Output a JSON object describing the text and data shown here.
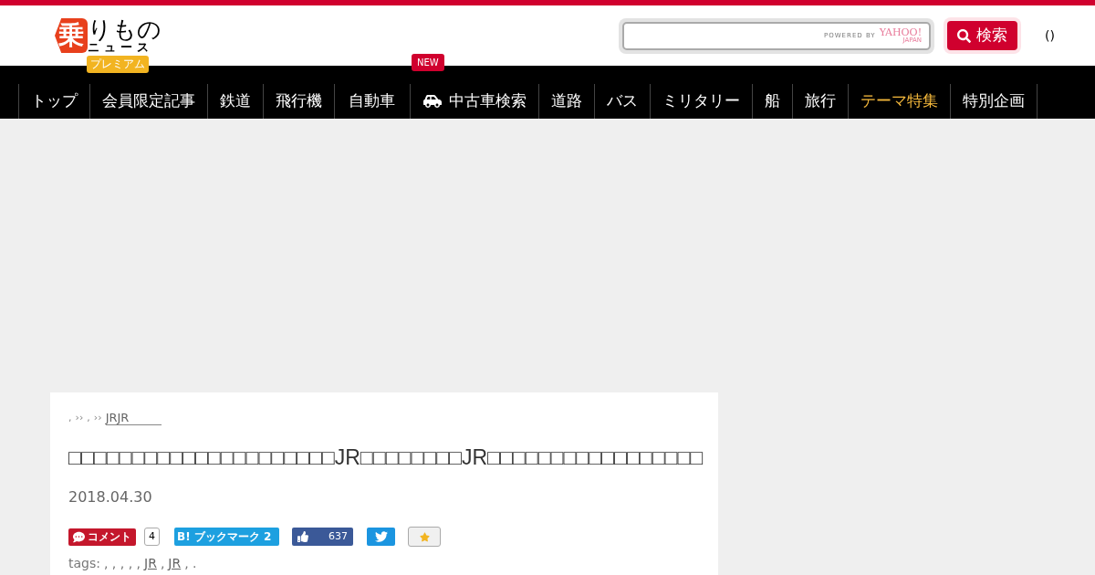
{
  "logo": {
    "mark": "乗",
    "main": "りもの",
    "sub": "ニュース",
    "badge": "プレミアム"
  },
  "search": {
    "powered_by": "POWERED BY",
    "provider": "YAHOO!",
    "provider_sub": "JAPAN",
    "button": "検索"
  },
  "header_link": "()",
  "nav": [
    {
      "label": "トップ",
      "highlighted": false
    },
    {
      "label": "会員限定記事",
      "highlighted": false
    },
    {
      "label": "鉄道",
      "highlighted": false
    },
    {
      "label": "飛行機",
      "highlighted": false
    },
    {
      "label": "自動車",
      "highlighted": false
    },
    {
      "label": "中古車検索",
      "highlighted": false,
      "has_icon": true,
      "badge": "NEW"
    },
    {
      "label": "道路",
      "highlighted": false
    },
    {
      "label": "バス",
      "highlighted": false
    },
    {
      "label": "ミリタリー",
      "highlighted": false
    },
    {
      "label": "船",
      "highlighted": false
    },
    {
      "label": "旅行",
      "highlighted": false
    },
    {
      "label": "テーマ特集",
      "highlighted": true
    },
    {
      "label": "特別企画",
      "highlighted": false
    }
  ],
  "article": {
    "breadcrumb": [
      {
        "text": ",",
        "link": false
      },
      {
        "text": "››",
        "link": false
      },
      {
        "text": ",",
        "link": false
      },
      {
        "text": "››",
        "link": false
      },
      {
        "text": "JRJR",
        "link": true
      }
    ],
    "title": "□□□□□□□□□□□□□□□□□□□□□JR□□□□□□□□JR□□□□□□□□□□□□□□□□□",
    "date": "2018.04.30",
    "share": {
      "comment": "コメント",
      "comment_count": "4",
      "bookmark": "B! ブックマーク 2",
      "like_count": "637"
    },
    "tags_label": "tags:",
    "tags": [
      {
        "text": ", , , , ,",
        "link": false
      },
      {
        "text": "JR",
        "link": true
      },
      {
        "text": ",",
        "link": false
      },
      {
        "text": "JR",
        "link": true
      },
      {
        "text": ", .",
        "link": false
      }
    ]
  }
}
